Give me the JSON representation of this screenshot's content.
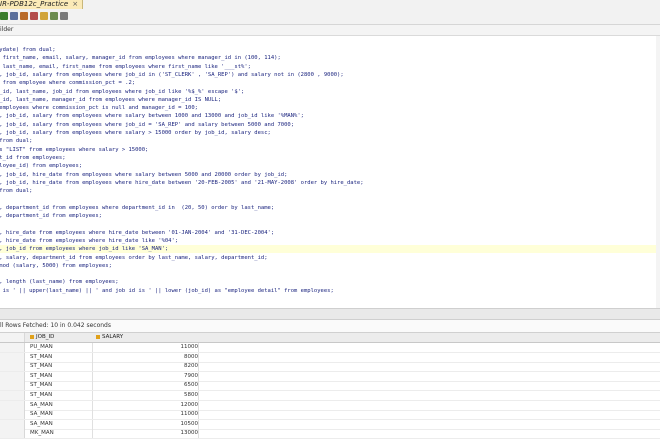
{
  "tab": {
    "title": "IR-PDB12c_Practice",
    "close": "×"
  },
  "subheader": {
    "label": "ilder"
  },
  "editor_lines": [
    "(ydate) from dual;",
    "l first_name, email, salary, manager_id from employees where manager_id in (100, 114);",
    "t last_name, email, first_name from employees where first_name like '___st%';",
    "e, job_id, salary from employees where job_id in ('ST_CLERK' , 'SA_REP') and salary not in (2800 , 9000);",
    "e from employee where commission_pct = .2;",
    "e_id, last_name, job_id from employees where job_id like '%$_%' escape '$';",
    "e_id, last_name, manager_id from employees where manager_id IS NULL;",
    " employees where commission_pct is null and manager_id = 100;",
    "e, job_id, salary from employees where salary between 1000 and 13000 and job_id like '%MAN%';",
    "e, job_id, salary from employees where job_id = 'SA_REP' and salary between 5000 and 7000;",
    "e, job_id, salary from employees where salary > 15000 order by job_id, salary desc;",
    " from dual;",
    "as \"LIST\" from employees where salary > 15000;",
    "nt_id from employees;",
    "ployee_id) from employees;",
    "e, job_id, hire_date from employees where salary between 5000 and 20000 order by job_id;",
    "e, job_id, hire_date from employees where hire_date between '20-FEB-2005' and '21-MAY-2008' order by hire_date;",
    " from dual;",
    "",
    "e, department_id from employees where department_id in  (20, 50) order by last_name;",
    "e, department_id from employees;",
    "",
    "e, hire_date from employees where hire_date between '01-JAN-2004' and '31-DEC-2004';",
    "e, hire_date from employees where hire_date like '%04';",
    "e, job_id from employees where job_id like 'SA_MAN';",
    "e, salary, department_id from employees order by last_name, salary, department_id;",
    " mod (salary, 5000) from employees;",
    "",
    "e, length (last_name) from employees;",
    "e is ' || upper(last_name) || ' and job id is ' || lower (job_id) as \"employee detail\" from employees;"
  ],
  "highlight_line": 24,
  "status": {
    "text": "ll Rows Fetched: 10 in 0.042 seconds"
  },
  "result_grid": {
    "columns": [
      "JOB_ID",
      "SALARY"
    ],
    "rows": [
      [
        "PU_MAN",
        "11000"
      ],
      [
        "ST_MAN",
        "8000"
      ],
      [
        "ST_MAN",
        "8200"
      ],
      [
        "ST_MAN",
        "7900"
      ],
      [
        "ST_MAN",
        "6500"
      ],
      [
        "ST_MAN",
        "5800"
      ],
      [
        "SA_MAN",
        "12000"
      ],
      [
        "SA_MAN",
        "11000"
      ],
      [
        "SA_MAN",
        "10500"
      ],
      [
        "MK_MAN",
        "13000"
      ]
    ]
  },
  "colors": {
    "tab_active": "#fbeab7",
    "editor_text": "#1a237e",
    "highlight": "#ffffd8"
  }
}
